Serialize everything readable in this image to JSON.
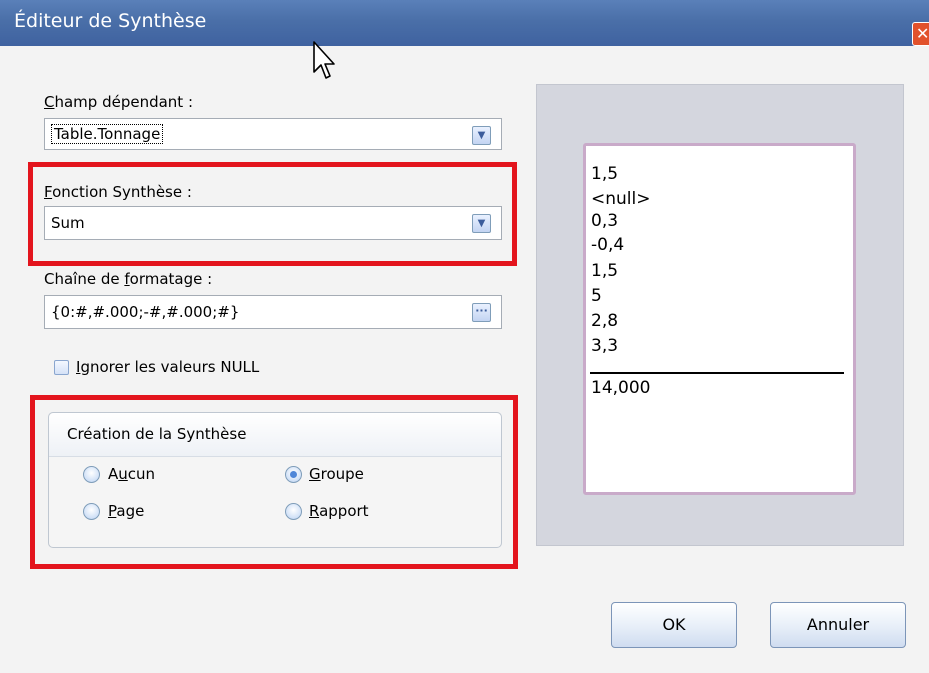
{
  "window": {
    "title": "Éditeur de Synthèse",
    "close_symbol": "✕"
  },
  "dependent_field": {
    "label_first": "C",
    "label_rest": "hamp dépendant :",
    "value": "Table.Tonnage"
  },
  "summary_function": {
    "label_first": "F",
    "label_rest": "onction Synthèse :",
    "value": "Sum"
  },
  "format_string": {
    "label_before": "Chaîne de ",
    "label_underlined": "f",
    "label_after": "ormatage :",
    "value": "{0:#,#.000;-#,#.000;#}",
    "button_label": "···"
  },
  "ignore_null": {
    "label_first": "I",
    "label_rest": "gnorer les valeurs NULL",
    "checked": false
  },
  "creation": {
    "title": "Création de la Synthèse",
    "options": [
      {
        "pre": "A",
        "underlined": "u",
        "post": "cun",
        "checked": false
      },
      {
        "pre": "",
        "underlined": "G",
        "post": "roupe",
        "checked": true
      },
      {
        "pre": "",
        "underlined": "P",
        "post": "age",
        "checked": false
      },
      {
        "pre": "",
        "underlined": "R",
        "post": "apport",
        "checked": false
      }
    ]
  },
  "preview": {
    "values": [
      "1,5",
      "<null>",
      "0,3",
      "-0,4",
      "1,5",
      "5",
      "2,8",
      "3,3"
    ],
    "total": "14,000"
  },
  "buttons": {
    "ok": "OK",
    "cancel": "Annuler"
  },
  "colors": {
    "highlight": "#e3141d",
    "titlebar": "#4a6fa8",
    "preview_border": "#c9aac9"
  }
}
